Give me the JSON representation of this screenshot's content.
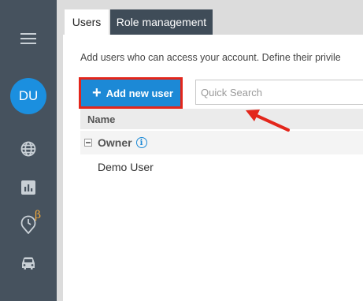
{
  "sidebar": {
    "avatar_initials": "DU",
    "beta_badge": "β",
    "icons": [
      "menu-icon",
      "globe-icon",
      "chart-icon",
      "clock-location-icon",
      "car-icon"
    ]
  },
  "tabs": [
    {
      "label": "Users",
      "active": true
    },
    {
      "label": "Role management",
      "active": false
    }
  ],
  "main": {
    "description": "Add users who can access your account. Define their privile",
    "add_button_label": "Add new user",
    "search_placeholder": "Quick Search",
    "column_header": "Name",
    "group": {
      "label": "Owner"
    },
    "users": [
      "Demo User"
    ]
  },
  "colors": {
    "sidebar": "#46525e",
    "accent": "#1c89d6",
    "highlight": "#e3261b",
    "beta": "#f2a93b"
  }
}
